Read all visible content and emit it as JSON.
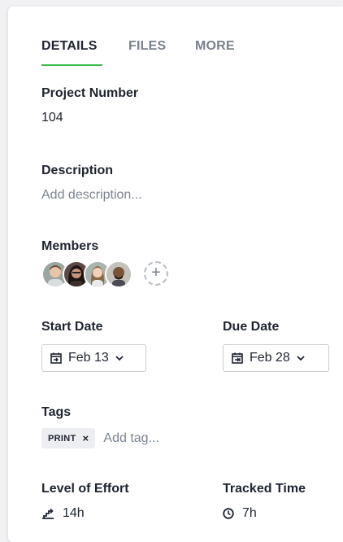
{
  "tabs": [
    {
      "label": "DETAILS",
      "active": true
    },
    {
      "label": "FILES",
      "active": false
    },
    {
      "label": "MORE",
      "active": false
    }
  ],
  "project_number": {
    "label": "Project Number",
    "value": "104"
  },
  "description": {
    "label": "Description",
    "placeholder": "Add description..."
  },
  "members": {
    "label": "Members",
    "avatars": [
      "member-1",
      "member-2",
      "member-3",
      "member-4"
    ],
    "add_icon": "plus-icon"
  },
  "start_date": {
    "label": "Start Date",
    "value": "Feb 13",
    "icon": "calendar-start-icon"
  },
  "due_date": {
    "label": "Due Date",
    "value": "Feb 28",
    "icon": "calendar-due-icon"
  },
  "tags": {
    "label": "Tags",
    "items": [
      {
        "label": "PRINT",
        "remove": "×"
      }
    ],
    "placeholder": "Add tag..."
  },
  "level_of_effort": {
    "label": "Level of Effort",
    "value": "14h",
    "icon": "effort-icon"
  },
  "tracked_time": {
    "label": "Tracked Time",
    "value": "7h",
    "icon": "clock-icon"
  },
  "colors": {
    "accent": "#3dbb4f",
    "muted": "#7a808c",
    "text": "#1f2430"
  }
}
